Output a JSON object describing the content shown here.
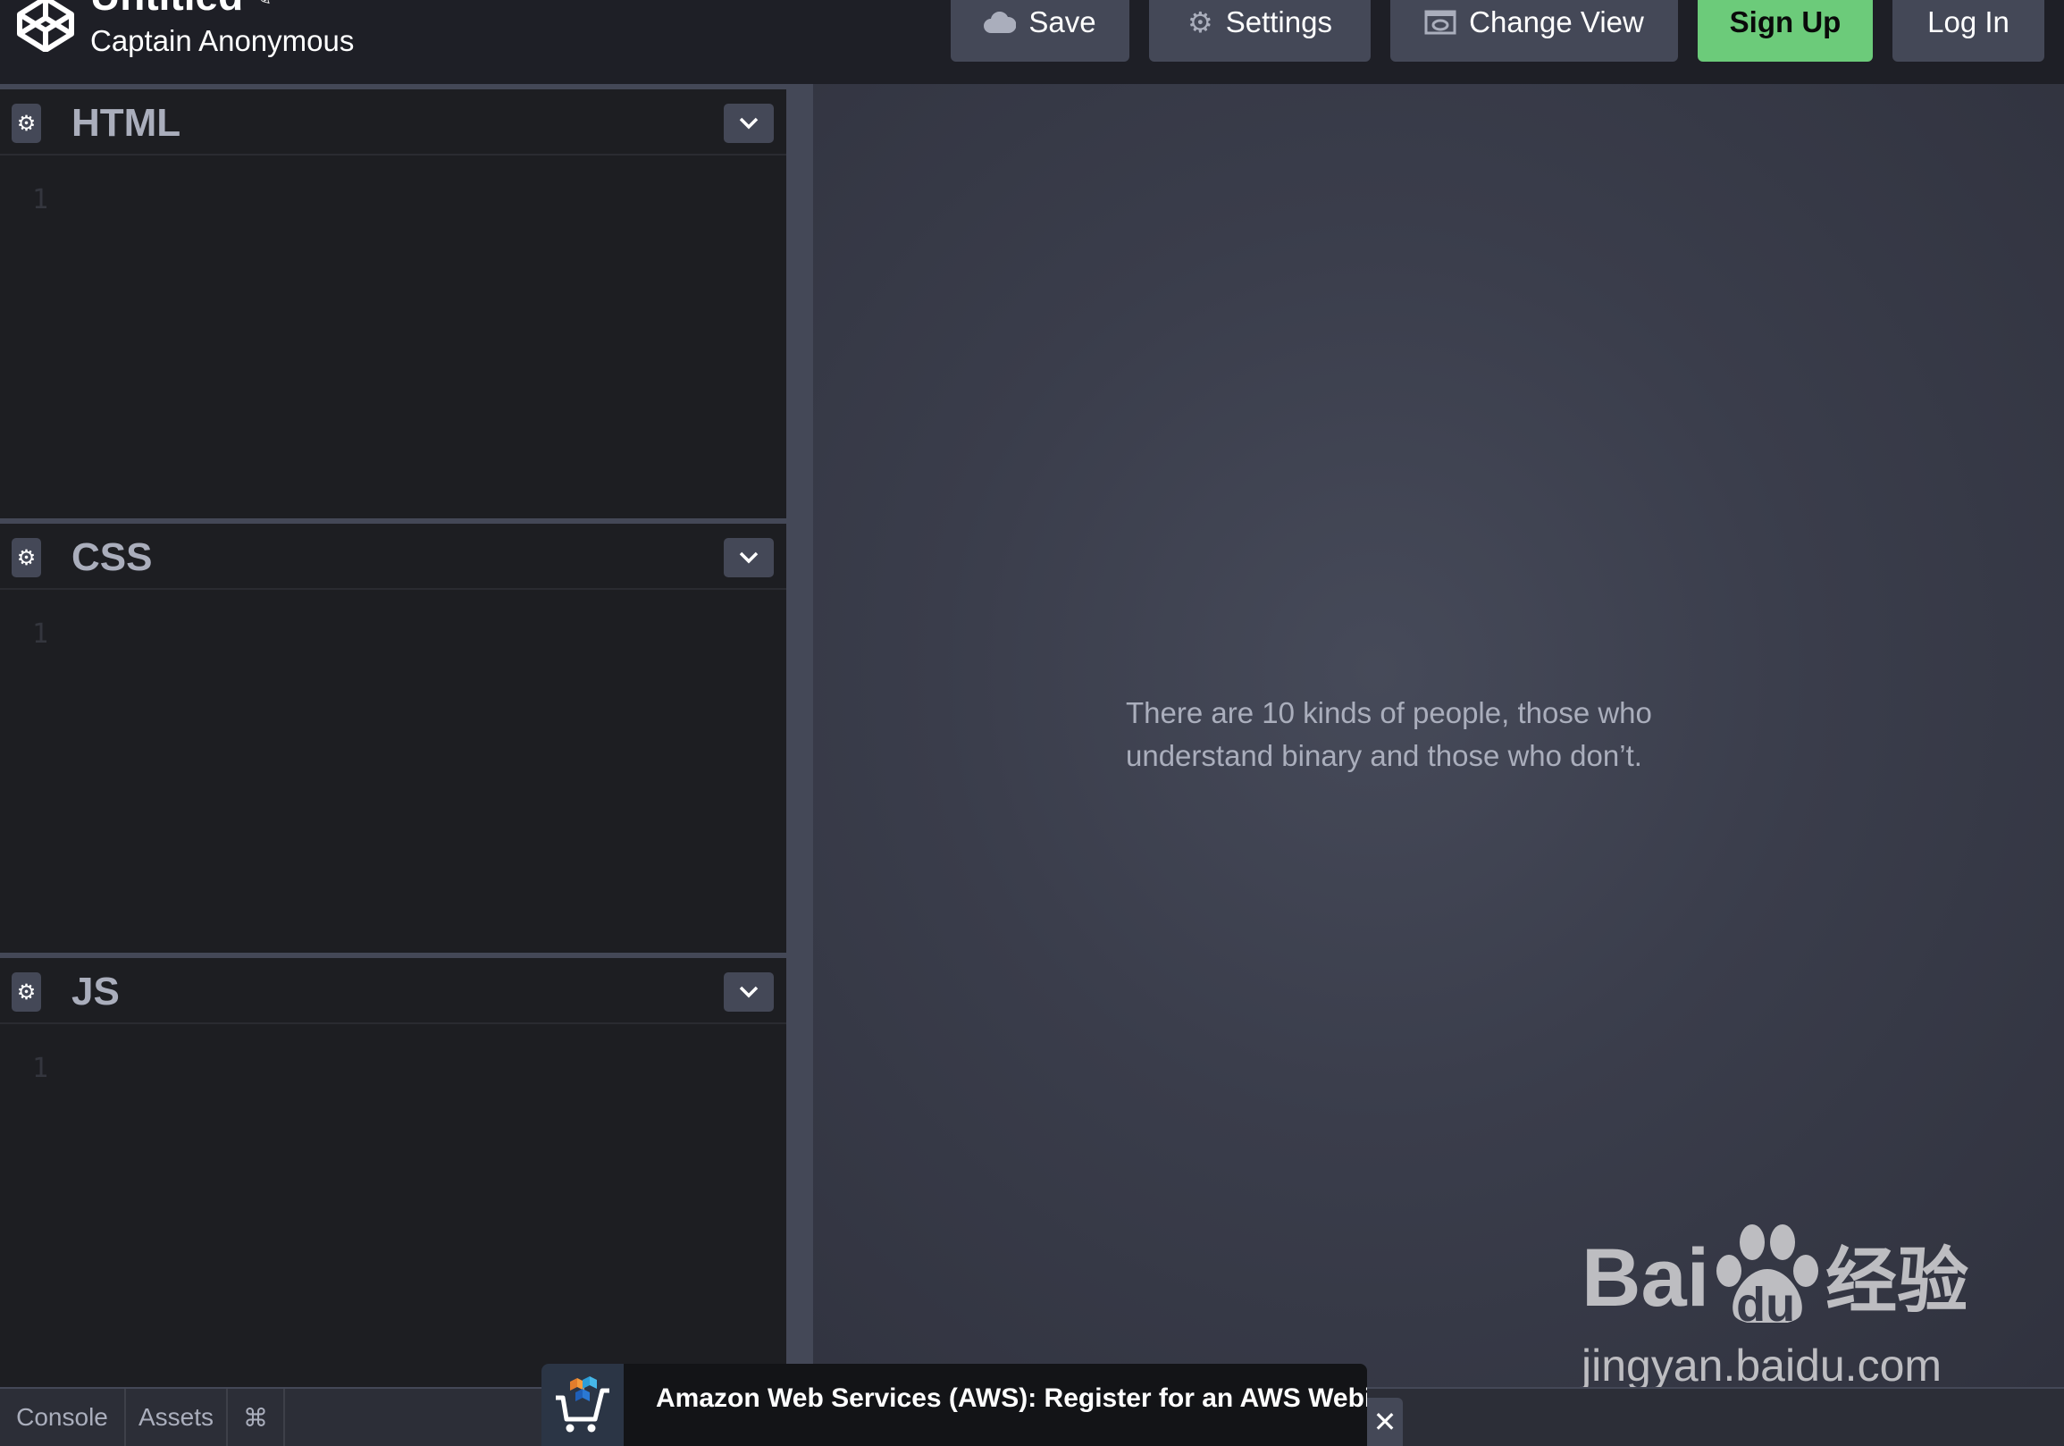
{
  "header": {
    "title": "Untitled",
    "owner": "Captain Anonymous",
    "buttons": {
      "save": "Save",
      "settings": "Settings",
      "change_view": "Change View",
      "sign_up": "Sign Up",
      "log_in": "Log In"
    },
    "icons": {
      "logo": "codepen-logo-icon",
      "edit_title": "pencil-icon",
      "save": "cloud-icon",
      "settings": "gear-icon",
      "change_view": "layout-eye-icon"
    }
  },
  "editors": [
    {
      "name": "HTML",
      "line_number": "1"
    },
    {
      "name": "CSS",
      "line_number": "1"
    },
    {
      "name": "JS",
      "line_number": "1"
    }
  ],
  "preview": {
    "text": "There are 10 kinds of people, those who understand binary and those who don’t."
  },
  "bottom_bar": {
    "console": "Console",
    "assets": "Assets",
    "shortcuts": "⌘"
  },
  "ad": {
    "text": "Amazon Web Services (AWS): Register for an AWS Webinar",
    "close": "✕"
  },
  "watermark": {
    "brand_latin": "Bai",
    "brand_paw_text": "du",
    "brand_cjk": "经验",
    "url": "jingyan.baidu.com"
  },
  "colors": {
    "signup_green": "#6ccb7a",
    "button_gray": "#444857",
    "editor_bg": "#1d1e22",
    "header_bg": "#1e1f26",
    "muted_text": "#aaaebc"
  }
}
